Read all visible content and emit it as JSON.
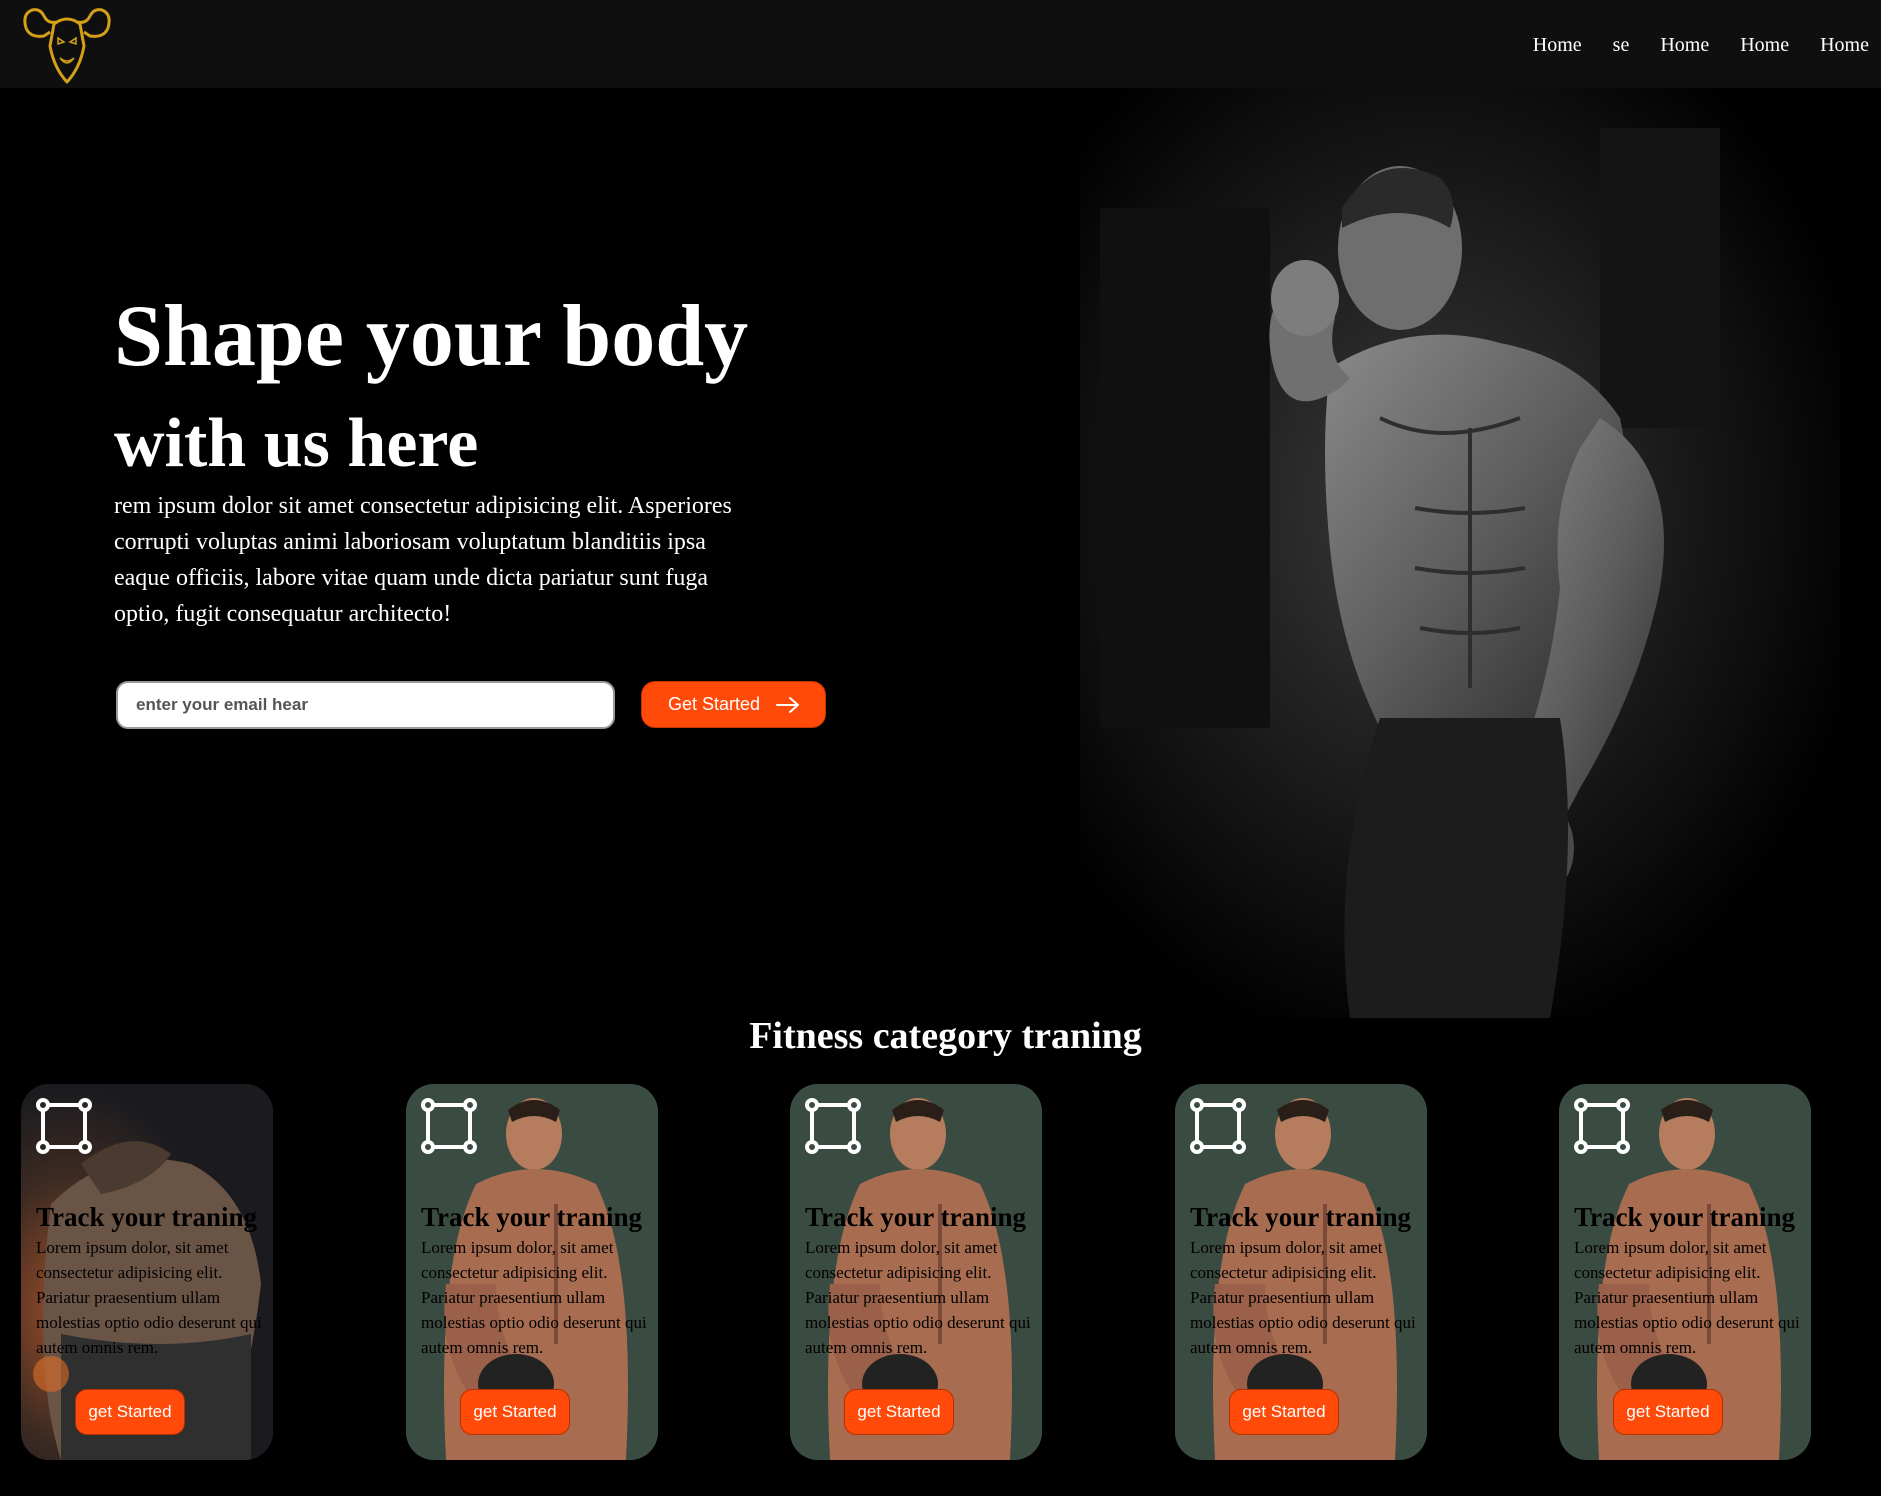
{
  "header": {
    "logo_icon": "bodybuilder-logo-icon",
    "nav": [
      "Home",
      "se",
      "Home",
      "Home",
      "Home"
    ]
  },
  "hero": {
    "title_line1": "Shape your body",
    "title_line2": "with us here",
    "text": "rem ipsum dolor sit amet consectetur adipisicing elit. Asperiores corrupti voluptas animi laboriosam voluptatum blanditiis ipsa eaque officiis, labore vitae quam unde dicta pariatur sunt fuga optio, fugit consequatur architecto!",
    "email_placeholder": "enter your email hear",
    "cta_label": "Get Started",
    "cta_icon": "arrow-right-icon"
  },
  "section": {
    "title": "Fitness category traning"
  },
  "cards": [
    {
      "title": "Track your traning",
      "text": "Lorem ipsum dolor, sit amet consectetur adipisicing elit. Pariatur praesentium ullam molestias optio odio deserunt qui autem omnis rem.",
      "button": "get Started",
      "icon": "bounding-square-icon"
    },
    {
      "title": "Track your traning",
      "text": "Lorem ipsum dolor, sit amet consectetur adipisicing elit. Pariatur praesentium ullam molestias optio odio deserunt qui autem omnis rem.",
      "button": "get Started",
      "icon": "bounding-square-icon"
    },
    {
      "title": "Track your traning",
      "text": "Lorem ipsum dolor, sit amet consectetur adipisicing elit. Pariatur praesentium ullam molestias optio odio deserunt qui autem omnis rem.",
      "button": "get Started",
      "icon": "bounding-square-icon"
    },
    {
      "title": "Track your traning",
      "text": "Lorem ipsum dolor, sit amet consectetur adipisicing elit. Pariatur praesentium ullam molestias optio odio deserunt qui autem omnis rem.",
      "button": "get Started",
      "icon": "bounding-square-icon"
    },
    {
      "title": "Track your traning",
      "text": "Lorem ipsum dolor, sit amet consectetur adipisicing elit. Pariatur praesentium ullam molestias optio odio deserunt qui autem omnis rem.",
      "button": "get Started",
      "icon": "bounding-square-icon"
    }
  ],
  "colors": {
    "accent": "#ff4a0a",
    "header_bg": "#0f0f0f",
    "card_bg": "#3a4b42",
    "logo_gold": "#d4a017"
  }
}
